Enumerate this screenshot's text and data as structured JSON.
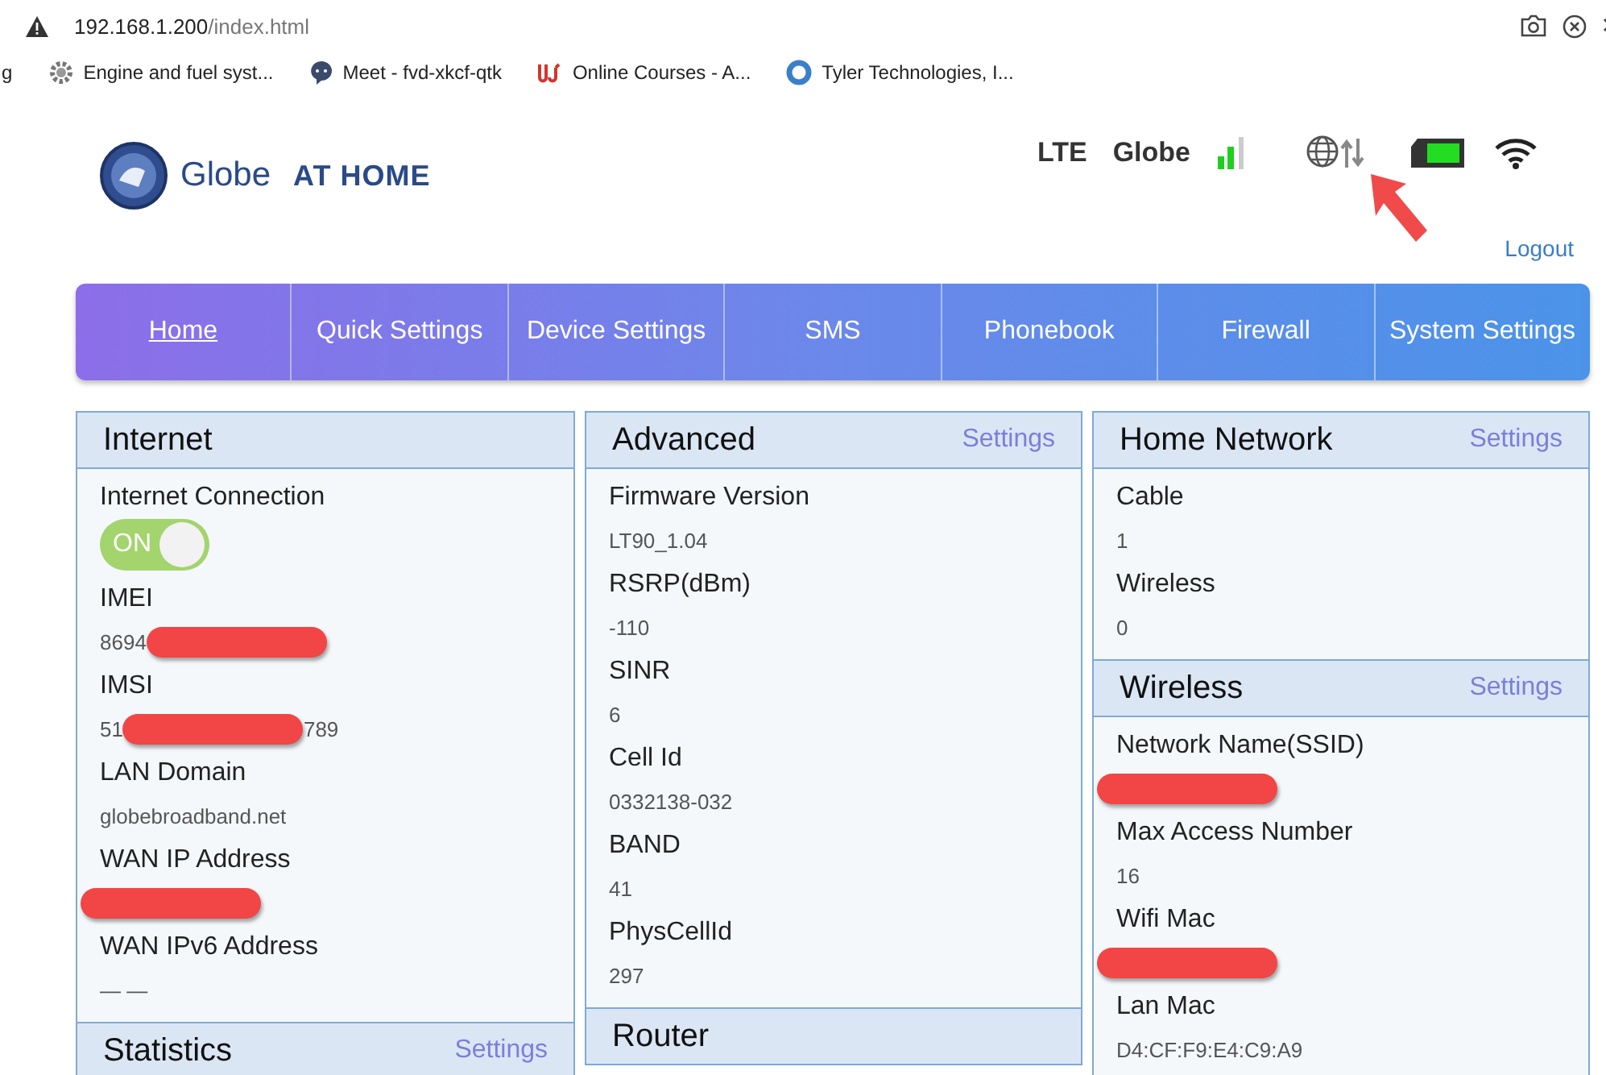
{
  "browser": {
    "address_host": "192.168.1.200",
    "address_path": "/index.html",
    "bookmarks": [
      {
        "kind": "none",
        "label": "g"
      },
      {
        "kind": "gear",
        "label": "Engine and fuel syst..."
      },
      {
        "kind": "chat",
        "label": "Meet - fvd-xkcf-qtk"
      },
      {
        "kind": "mark",
        "label": "Online Courses - A..."
      },
      {
        "kind": "ring",
        "label": "Tyler Technologies, I..."
      }
    ]
  },
  "header": {
    "brand": "Globe",
    "brand_tag": "AT HOME",
    "network_type": "LTE",
    "carrier": "Globe",
    "logout": "Logout"
  },
  "nav": [
    {
      "label": "Home",
      "selected": true
    },
    {
      "label": "Quick Settings",
      "selected": false
    },
    {
      "label": "Device Settings",
      "selected": false
    },
    {
      "label": "SMS",
      "selected": false
    },
    {
      "label": "Phonebook",
      "selected": false
    },
    {
      "label": "Firewall",
      "selected": false
    },
    {
      "label": "System Settings",
      "selected": false
    }
  ],
  "columns": [
    [
      {
        "title": "Internet",
        "fields": [
          {
            "kind": "toggle",
            "label": "Internet Connection",
            "toggle_text": "ON",
            "on": true
          },
          {
            "kind": "text",
            "label": "IMEI",
            "value_start": "8694",
            "redacted": true
          },
          {
            "kind": "text",
            "label": "IMSI",
            "value_start": "51",
            "value_end": "789",
            "redacted": true
          },
          {
            "kind": "text",
            "label": "LAN Domain",
            "value_start": "globebroadband.net"
          },
          {
            "kind": "text",
            "label": "WAN IP Address",
            "redacted": true
          },
          {
            "kind": "text",
            "label": "WAN IPv6 Address",
            "value_start": "— —"
          }
        ]
      },
      {
        "title": "Statistics",
        "settings": "Settings"
      }
    ],
    [
      {
        "title": "Advanced",
        "settings": "Settings",
        "fields": [
          {
            "kind": "text",
            "label": "Firmware Version",
            "value_start": "LT90_1.04"
          },
          {
            "kind": "text",
            "label": "RSRP(dBm)",
            "value_start": "-110"
          },
          {
            "kind": "text",
            "label": "SINR",
            "value_start": "6"
          },
          {
            "kind": "text",
            "label": "Cell Id",
            "value_start": "0332138-032"
          },
          {
            "kind": "text",
            "label": "BAND",
            "value_start": "41"
          },
          {
            "kind": "text",
            "label": "PhysCellId",
            "value_start": "297"
          }
        ]
      },
      {
        "title": "Router"
      }
    ],
    [
      {
        "title": "Home Network",
        "settings": "Settings",
        "fields": [
          {
            "kind": "text",
            "label": "Cable",
            "value_start": "1"
          },
          {
            "kind": "text",
            "label": "Wireless",
            "value_start": "0"
          }
        ]
      },
      {
        "title": "Wireless",
        "settings": "Settings",
        "fields": [
          {
            "kind": "text",
            "label": "Network Name(SSID)",
            "redacted": true
          },
          {
            "kind": "text",
            "label": "Max Access Number",
            "value_start": "16"
          },
          {
            "kind": "text",
            "label": "Wifi Mac",
            "redacted": true
          },
          {
            "kind": "text",
            "label": "Lan Mac",
            "value_start": "D4:CF:F9:E4:C9:A9"
          }
        ]
      }
    ]
  ]
}
